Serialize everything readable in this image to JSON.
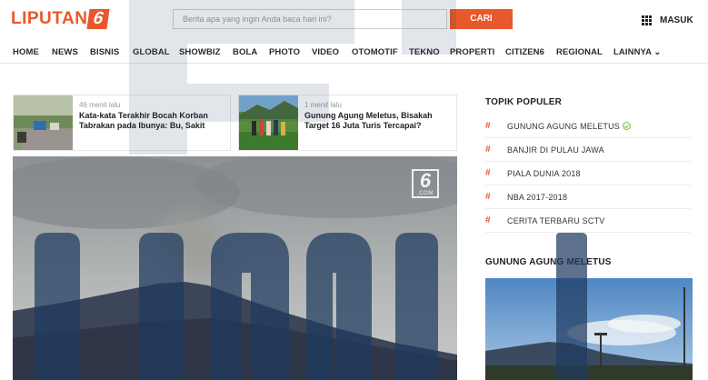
{
  "header": {
    "logo_text": "LIPUTAN",
    "logo_number": "6",
    "search_placeholder": "Berita apa yang ingin Anda baca hari ini?",
    "search_button": "CARI",
    "login_label": "MASUK"
  },
  "nav": {
    "items": [
      "HOME",
      "NEWS",
      "BISNIS",
      "GLOBAL",
      "SHOWBIZ",
      "BOLA",
      "PHOTO",
      "VIDEO",
      "OTOMOTIF",
      "TEKNO",
      "PROPERTI",
      "CITIZEN6",
      "REGIONAL",
      "LAINNYA ⌄"
    ]
  },
  "cards": [
    {
      "time": "46 menit lalu",
      "title_line1": "Kata-kata Terakhir Bocah Korban",
      "title_line2": "Tabrakan pada Ibunya: Bu, Sakit"
    },
    {
      "time": "1 menit lalu",
      "title_line1": "Gunung Agung Meletus, Bisakah",
      "title_line2": "Target 16 Juta Turis Tercapai?"
    }
  ],
  "hero": {
    "badge_number": "6",
    "badge_text": ".COM"
  },
  "sidebar": {
    "popular_heading": "TOPIK POPULER",
    "topics": [
      {
        "label": "GUNUNG AGUNG MELETUS",
        "verified": true
      },
      {
        "label": "BANJIR DI PULAU JAWA",
        "verified": false
      },
      {
        "label": "PIALA DUNIA 2018",
        "verified": false
      },
      {
        "label": "NBA 2017-2018",
        "verified": false
      },
      {
        "label": "CERITA TERBARU SCTV",
        "verified": false
      }
    ],
    "section_heading": "GUNUNG AGUNG MELETUS"
  },
  "colors": {
    "brand": "#e8582a",
    "verified": "#7ac142",
    "watermark": "#1e3a5f"
  },
  "icons": {
    "grid": "grid-icon",
    "hash": "hash-icon",
    "verified": "check-circle-icon"
  }
}
